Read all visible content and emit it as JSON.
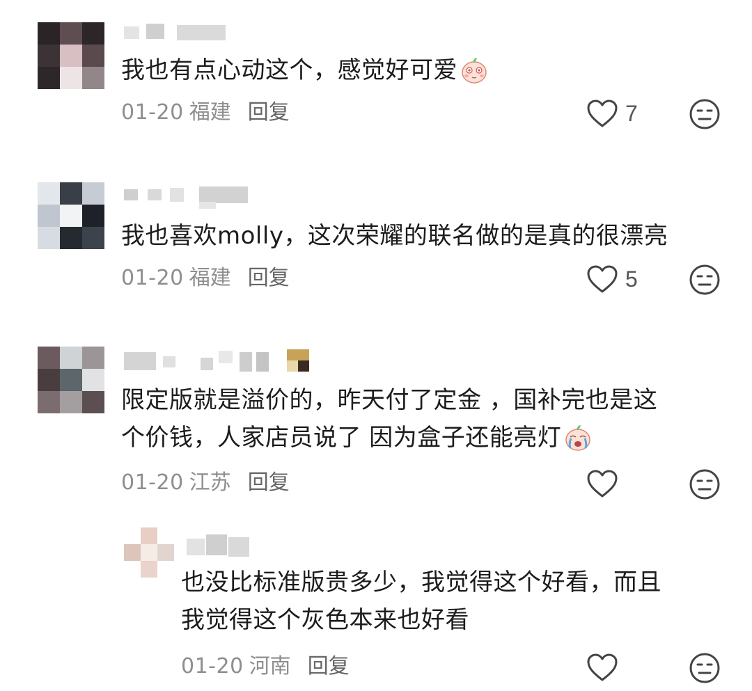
{
  "comments": [
    {
      "text_lines": [
        "我也有点心动这个，感觉好可爱"
      ],
      "date": "01-20",
      "location": "福建",
      "reply_label": "回复",
      "likes": "7"
    },
    {
      "text_lines": [
        "我也喜欢molly，这次荣耀的联名做的是真的很漂亮"
      ],
      "date": "01-20",
      "location": "福建",
      "reply_label": "回复",
      "likes": "5"
    },
    {
      "text_lines": [
        "限定版就是溢价的，昨天付了定金 ，国补完也是这",
        "个价钱，人家店员说了 因为盒子还能亮灯"
      ],
      "date": "01-20",
      "location": "江苏",
      "reply_label": "回复",
      "likes": ""
    },
    {
      "text_lines": [
        "也没比标准版贵多少，我觉得这个好看，而且",
        "我觉得这个灰色本来也好看"
      ],
      "date": "01-20",
      "location": "河南",
      "reply_label": "回复",
      "likes": ""
    }
  ],
  "icons": {
    "like": "heart-outline-icon",
    "dislike": "meh-face-icon",
    "emoji_1": "shy-peach-emoji",
    "emoji_2": "crying-peach-emoji"
  },
  "colors": {
    "text": "#1c1c1c",
    "meta": "#8e8e8e",
    "icon": "#444444"
  }
}
